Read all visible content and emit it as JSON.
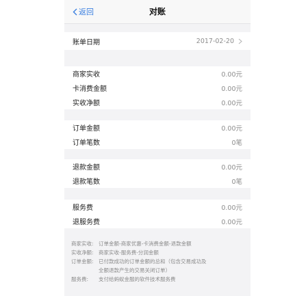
{
  "nav": {
    "back_label": "返回",
    "title": "对账"
  },
  "bill_date": {
    "label": "账单日期",
    "value": "2017-02-20"
  },
  "sections": [
    {
      "rows": [
        {
          "label": "商家实收",
          "value": "0.00元"
        },
        {
          "label": "卡消费金额",
          "value": "0.00元"
        },
        {
          "label": "实收净额",
          "value": "0.00元"
        }
      ]
    },
    {
      "rows": [
        {
          "label": "订单金额",
          "value": "0.00元"
        },
        {
          "label": "订单笔数",
          "value": "0笔"
        }
      ]
    },
    {
      "rows": [
        {
          "label": "退款金额",
          "value": "0.00元"
        },
        {
          "label": "退款笔数",
          "value": "0笔"
        }
      ]
    },
    {
      "rows": [
        {
          "label": "服务费",
          "value": "0.00元"
        },
        {
          "label": "退服务费",
          "value": "0.00元"
        }
      ]
    }
  ],
  "notes": [
    {
      "key": "商家实收:",
      "text": "订单金额-商家优惠-卡消费金额-退款金额"
    },
    {
      "key": "实收净额:",
      "text": "商家实收-服务费-分润金额"
    },
    {
      "key": "订单金额:",
      "text": "已付款成功的订单金额的总和（包含交易成功及"
    },
    {
      "key": "",
      "text": "全额退款产生的交易关闭订单）"
    },
    {
      "key": "服务费:",
      "text": "支付给蚂蚁金服的软件技术服务费"
    }
  ]
}
